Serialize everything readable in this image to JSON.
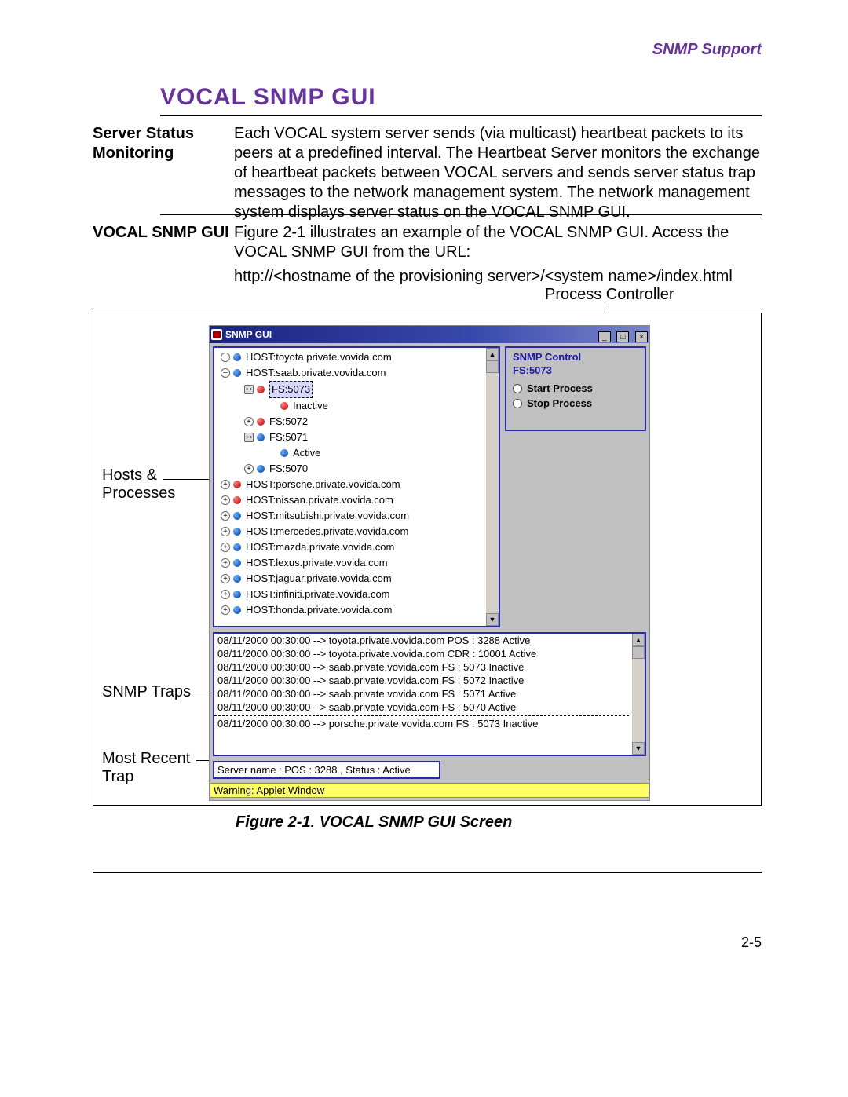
{
  "header": {
    "right": "SNMP Support"
  },
  "title": "VOCAL SNMP GUI",
  "section1": {
    "label": "Server Status Monitoring",
    "body": "Each VOCAL system server sends (via multicast) heartbeat packets to its peers at a predefined interval. The Heartbeat Server monitors the exchange of heartbeat packets between VOCAL servers and sends server status trap messages to the network management system. The network management system displays server status on the VOCAL SNMP GUI."
  },
  "section2": {
    "label": "VOCAL SNMP GUI",
    "line1": "Figure 2-1 illustrates an example of the VOCAL SNMP GUI. Access the VOCAL SNMP GUI from the URL:",
    "line2": "http://<hostname of the provisioning server>/<system name>/index.html"
  },
  "annotations": {
    "process_controller": "Process Controller",
    "hosts": "Hosts & Processes",
    "snmp_traps": "SNMP Traps",
    "most_recent_trap": "Most Recent Trap"
  },
  "gui": {
    "title": "SNMP GUI",
    "tree": [
      {
        "indent": 1,
        "toggle": "minus",
        "bullet": "blue",
        "label": "HOST:toyota.private.vovida.com"
      },
      {
        "indent": 1,
        "toggle": "minus",
        "bullet": "blue",
        "label": "HOST:saab.private.vovida.com"
      },
      {
        "indent": 2,
        "toggle": "key",
        "bullet": "red",
        "label": "FS:5073",
        "selected": true
      },
      {
        "indent": 3,
        "toggle": "",
        "bullet": "red",
        "label": "Inactive"
      },
      {
        "indent": 2,
        "toggle": "plus",
        "bullet": "red",
        "label": "FS:5072"
      },
      {
        "indent": 2,
        "toggle": "key",
        "bullet": "blue",
        "label": "FS:5071"
      },
      {
        "indent": 3,
        "toggle": "",
        "bullet": "blue",
        "label": "Active"
      },
      {
        "indent": 2,
        "toggle": "plus",
        "bullet": "blue",
        "label": "FS:5070"
      },
      {
        "indent": 1,
        "toggle": "plus",
        "bullet": "red",
        "label": "HOST:porsche.private.vovida.com"
      },
      {
        "indent": 1,
        "toggle": "plus",
        "bullet": "red",
        "label": "HOST:nissan.private.vovida.com"
      },
      {
        "indent": 1,
        "toggle": "plus",
        "bullet": "blue",
        "label": "HOST:mitsubishi.private.vovida.com"
      },
      {
        "indent": 1,
        "toggle": "plus",
        "bullet": "blue",
        "label": "HOST:mercedes.private.vovida.com"
      },
      {
        "indent": 1,
        "toggle": "plus",
        "bullet": "blue",
        "label": "HOST:mazda.private.vovida.com"
      },
      {
        "indent": 1,
        "toggle": "plus",
        "bullet": "blue",
        "label": "HOST:lexus.private.vovida.com"
      },
      {
        "indent": 1,
        "toggle": "plus",
        "bullet": "blue",
        "label": "HOST:jaguar.private.vovida.com"
      },
      {
        "indent": 1,
        "toggle": "plus",
        "bullet": "blue",
        "label": "HOST:infiniti.private.vovida.com"
      },
      {
        "indent": 1,
        "toggle": "plus",
        "bullet": "blue",
        "label": "HOST:honda.private.vovida.com"
      }
    ],
    "control": {
      "title": "SNMP Control",
      "sub": "FS:5073",
      "opt1": "Start Process",
      "opt2": "Stop Process"
    },
    "log": [
      "08/11/2000 00:30:00 --> toyota.private.vovida.com  POS : 3288  Active",
      "08/11/2000 00:30:00 --> toyota.private.vovida.com  CDR : 10001  Active",
      "08/11/2000 00:30:00 --> saab.private.vovida.com  FS : 5073  Inactive",
      "08/11/2000 00:30:00 --> saab.private.vovida.com  FS : 5072  Inactive",
      "08/11/2000 00:30:00 --> saab.private.vovida.com  FS : 5071  Active",
      "08/11/2000 00:30:00 --> saab.private.vovida.com  FS : 5070  Active",
      "08/11/2000 00:30:00 --> porsche.private.vovida.com  FS : 5073  Inactive"
    ],
    "status": "Server name : POS : 3288 ,  Status : Active",
    "warning": "Warning: Applet Window"
  },
  "figure_caption": "Figure 2-1. VOCAL SNMP GUI Screen",
  "page_number": "2-5"
}
